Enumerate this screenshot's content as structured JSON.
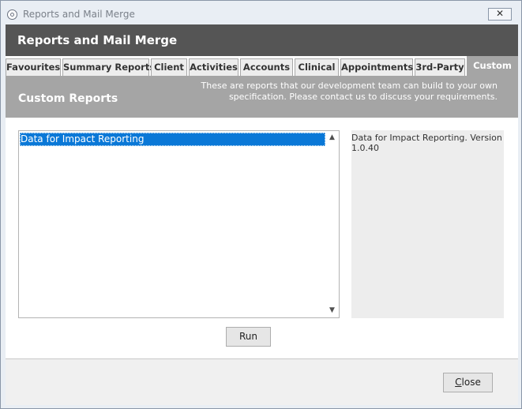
{
  "window": {
    "title": "Reports and Mail Merge",
    "close_glyph": "✕"
  },
  "header": {
    "title": "Reports and Mail Merge"
  },
  "tabs": [
    {
      "label": "Favourites"
    },
    {
      "label": "Summary Reports"
    },
    {
      "label": "Client"
    },
    {
      "label": "Activities"
    },
    {
      "label": "Accounts"
    },
    {
      "label": "Clinical"
    },
    {
      "label": "Appointments"
    },
    {
      "label": "3rd-Party"
    },
    {
      "label": "Custom",
      "active": true
    }
  ],
  "panel": {
    "title": "Custom Reports",
    "description": "These are reports that our development team can build to your own specification. Please contact us to discuss your requirements."
  },
  "report_list": {
    "items": [
      "Data for Impact Reporting"
    ],
    "selected": "Data for Impact Reporting",
    "scroll_up_glyph": "▲",
    "scroll_down_glyph": "▼"
  },
  "info": {
    "text": "Data for Impact Reporting. Version 1.0.40"
  },
  "buttons": {
    "run": "Run",
    "close_first": "C",
    "close_rest": "lose"
  },
  "colors": {
    "header_bg": "#555555",
    "panel_bg": "#a5a5a5",
    "selection": "#0a78d7"
  }
}
